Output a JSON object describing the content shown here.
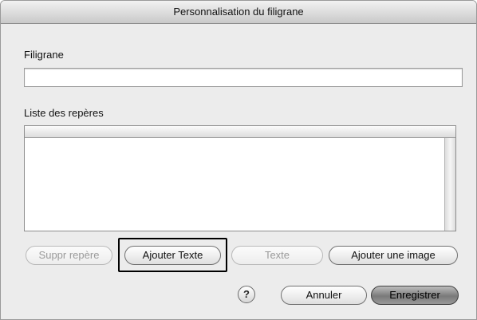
{
  "window": {
    "title": "Personnalisation du filigrane"
  },
  "watermark": {
    "label": "Filigrane",
    "value": "",
    "placeholder": ""
  },
  "marker_list": {
    "label": "Liste des repères",
    "items": []
  },
  "actions": {
    "delete_marker": "Suppr repère",
    "add_text": "Ajouter Texte",
    "text": "Texte",
    "add_image": "Ajouter une image"
  },
  "footer": {
    "help": "?",
    "cancel": "Annuler",
    "save": "Enregistrer"
  },
  "colors": {
    "window_bg": "#ececec",
    "focus_ring": "#000000",
    "primary_button": "#8a8a8a"
  },
  "state": {
    "focused_button": "add_text",
    "disabled_buttons": [
      "delete_marker",
      "text"
    ],
    "default_button": "save"
  }
}
